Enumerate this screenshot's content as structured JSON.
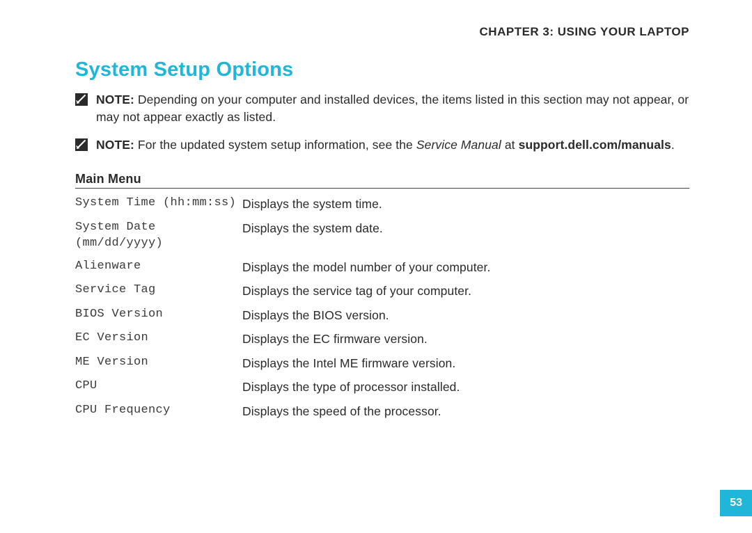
{
  "chapter_header": "CHAPTER 3: USING YOUR LAPTOP",
  "section_title": "System Setup Options",
  "notes": [
    {
      "label": "NOTE:",
      "text": " Depending on your computer and installed devices, the items listed in this section may not appear, or may not appear exactly as listed.",
      "italic": "",
      "tail": "",
      "bold_tail": ""
    },
    {
      "label": "NOTE:",
      "text": " For the updated system setup information, see the ",
      "italic": "Service Manual",
      "tail": " at ",
      "bold_tail": "support.dell.com/manuals"
    }
  ],
  "subsection_title": "Main Menu",
  "rows": [
    {
      "left": "System Time (hh:mm:ss)",
      "right": "Displays the system time."
    },
    {
      "left": "System Date (mm/dd/yyyy)",
      "right": "Displays the system date."
    },
    {
      "left": "Alienware",
      "right": "Displays the model number of your computer."
    },
    {
      "left": "Service Tag",
      "right": "Displays the service tag of your computer."
    },
    {
      "left": "BIOS Version",
      "right": "Displays the BIOS version."
    },
    {
      "left": "EC Version",
      "right": "Displays the EC firmware version."
    },
    {
      "left": "ME Version",
      "right": "Displays the Intel ME firmware version."
    },
    {
      "left": "CPU",
      "right": "Displays the type of processor installed."
    },
    {
      "left": "CPU Frequency",
      "right": "Displays the speed of the processor."
    }
  ],
  "page_number": "53"
}
